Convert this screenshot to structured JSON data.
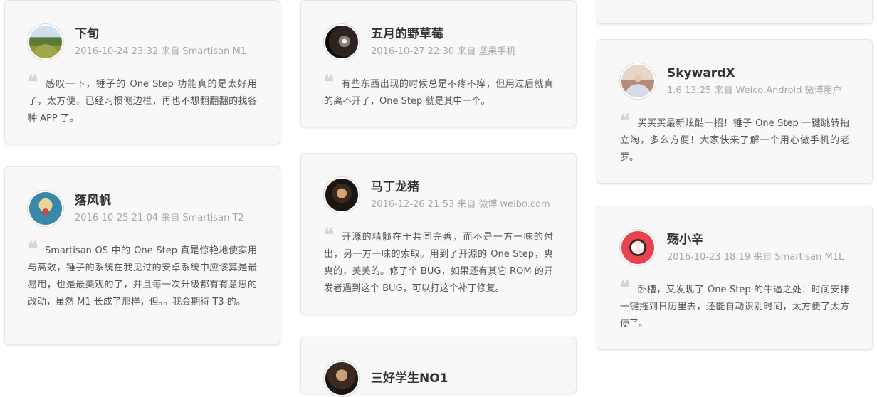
{
  "cards": [
    {
      "name": "下旬",
      "meta": "2016-10-24 23:32 来自 Smartisan M1",
      "text": "感叹一下，锤子的 One Step 功能真的是太好用了，太方便，已经习惯侧边栏，再也不想翻翻翻的找各种 APP 了。"
    },
    {
      "name": "落风帆",
      "meta": "2016-10-25 21:04 来自 Smartisan T2",
      "text": "Smartisan OS 中的 One Step 真是惊艳地使实用与高效，锤子的系统在我见过的安卓系统中应该算是最易用，也是最美观的了，并且每一次升级都有有意思的改动，虽然 M1 长成了那样，但。。我会期待 T3 的。"
    },
    {
      "name": "五月的野草莓",
      "meta": "2016-10-27 22:30 来自 坚果手机",
      "text": "有些东西出现的时候总是不疼不痒，但用过后就真的离不开了，One Step 就是其中一个。"
    },
    {
      "name": "马丁龙猪",
      "meta": "2016-12-26 21:53 来自 微博 weibo.com",
      "text": "开源的精髓在于共同完善，而不是一方一味的付出，另一方一味的索取。用到了开源的 One Step，爽爽的，美美的。修了个 BUG，如果还有其它 ROM 的开发者遇到这个 BUG，可以打这个补丁修复。"
    },
    {
      "name": "三好学生NO1",
      "meta": "",
      "text": ""
    },
    {
      "name": "SkywardX",
      "meta": "1.6 13:25 来自 Weico.Android 微博用户",
      "text": "买买买最新炫酷一招！锤子 One Step 一键跳转拍立淘，多么方便！大家快来了解一个用心做手机的老罗。"
    },
    {
      "name": "殇小辛",
      "meta": "2016-10-23 18:19 来自 Smartisan M1L",
      "text": "卧槽，又发现了 One Step 的牛逼之处：时间安排一键拖到日历里去，还能自动识别时间，太方便了太方便了。"
    }
  ],
  "quote_mark": "❝",
  "colors": {
    "card_bg": "#f8f8f8",
    "name": "#333333",
    "meta": "#a8a8a8",
    "quote_mark": "#d6d6d6"
  }
}
